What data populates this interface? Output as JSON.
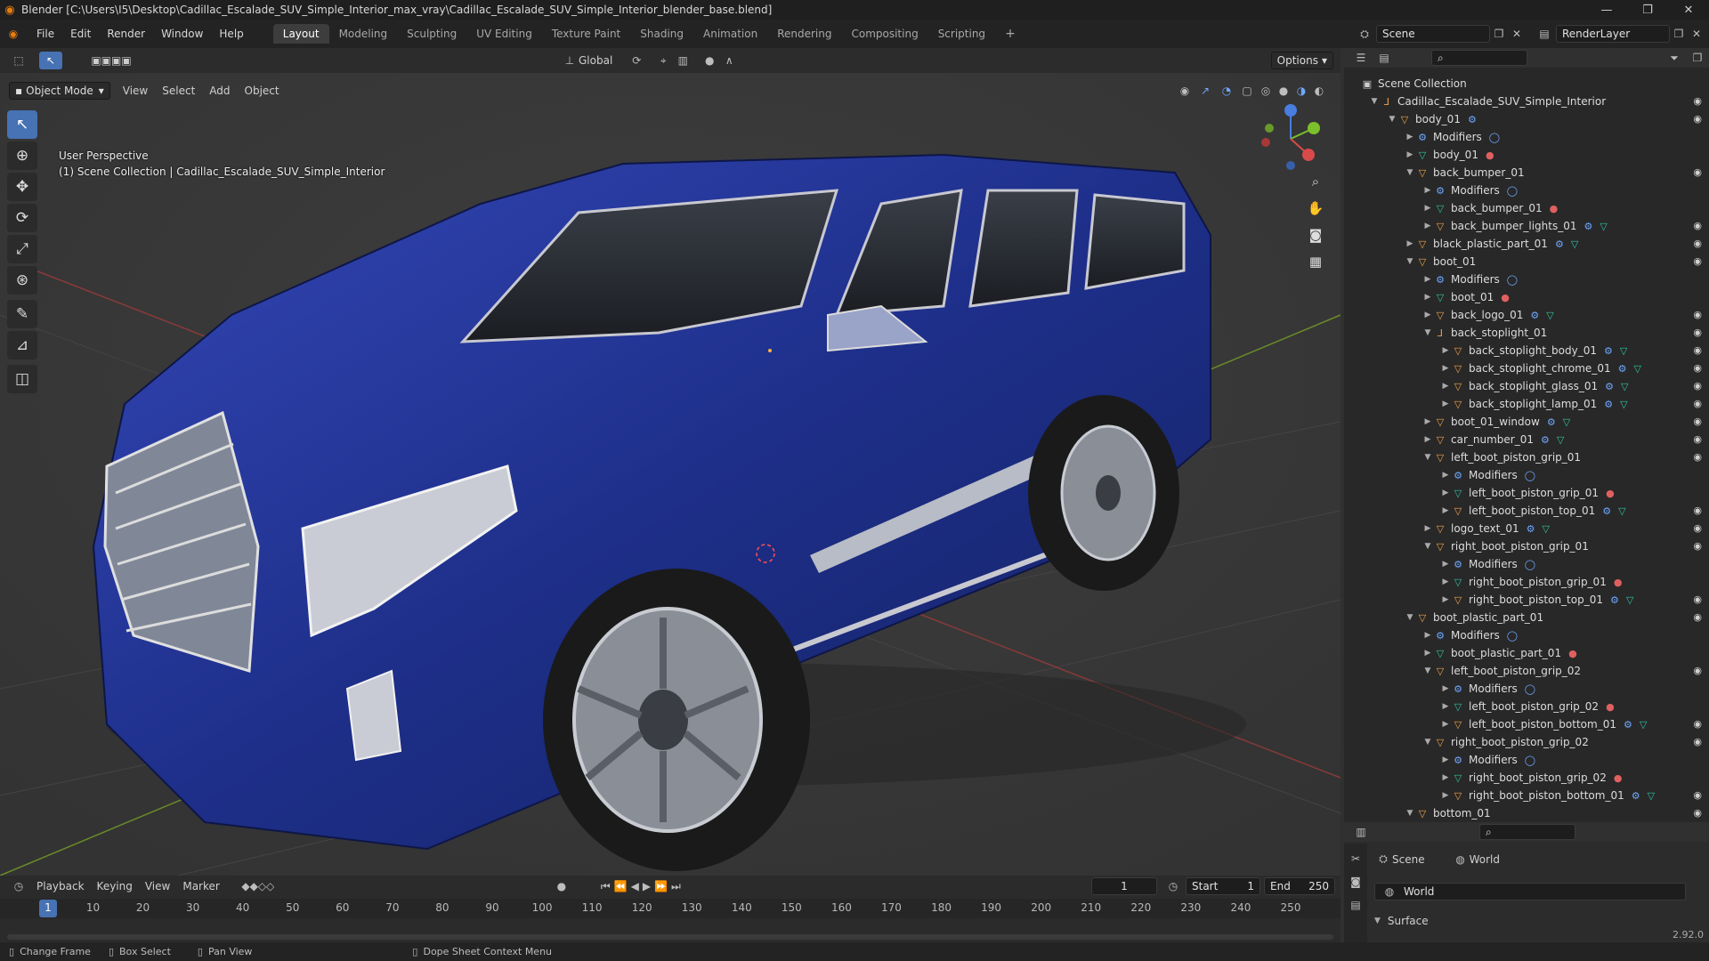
{
  "window": {
    "title": "Blender [C:\\Users\\I5\\Desktop\\Cadillac_Escalade_SUV_Simple_Interior_max_vray\\Cadillac_Escalade_SUV_Simple_Interior_blender_base.blend]"
  },
  "menu": [
    "File",
    "Edit",
    "Render",
    "Window",
    "Help"
  ],
  "workspaces": [
    {
      "label": "Layout",
      "active": true
    },
    {
      "label": "Modeling",
      "active": false
    },
    {
      "label": "Sculpting",
      "active": false
    },
    {
      "label": "UV Editing",
      "active": false
    },
    {
      "label": "Texture Paint",
      "active": false
    },
    {
      "label": "Shading",
      "active": false
    },
    {
      "label": "Animation",
      "active": false
    },
    {
      "label": "Rendering",
      "active": false
    },
    {
      "label": "Compositing",
      "active": false
    },
    {
      "label": "Scripting",
      "active": false
    }
  ],
  "scene": {
    "name": "Scene",
    "render_layer": "RenderLayer"
  },
  "viewport": {
    "mode": "Object Mode",
    "menus": [
      "View",
      "Select",
      "Add",
      "Object"
    ],
    "orientation": "Global",
    "options": "Options",
    "overlay_line1": "User Perspective",
    "overlay_line2": "(1) Scene Collection | Cadillac_Escalade_SUV_Simple_Interior"
  },
  "outliner": {
    "root": "Scene Collection",
    "rows": [
      {
        "label": "Cadillac_Escalade_SUV_Simple_Interior",
        "indent": 1,
        "type": "empty",
        "open": true,
        "eye": true
      },
      {
        "label": "body_01",
        "indent": 2,
        "type": "obj",
        "open": true,
        "eye": true,
        "extras": [
          "mod"
        ]
      },
      {
        "label": "Modifiers",
        "indent": 3,
        "type": "mod",
        "open": false,
        "eye": false,
        "extras": [
          "modset"
        ]
      },
      {
        "label": "body_01",
        "indent": 3,
        "type": "mesh",
        "open": false,
        "eye": false,
        "extras": [
          "mat"
        ]
      },
      {
        "label": "back_bumper_01",
        "indent": 3,
        "type": "obj",
        "open": true,
        "eye": true
      },
      {
        "label": "Modifiers",
        "indent": 4,
        "type": "mod",
        "open": false,
        "eye": false,
        "extras": [
          "modset"
        ]
      },
      {
        "label": "back_bumper_01",
        "indent": 4,
        "type": "mesh",
        "open": false,
        "eye": false,
        "extras": [
          "mat"
        ]
      },
      {
        "label": "back_bumper_lights_01",
        "indent": 4,
        "type": "obj",
        "open": false,
        "eye": true,
        "extras": [
          "mod",
          "mesh"
        ]
      },
      {
        "label": "black_plastic_part_01",
        "indent": 3,
        "type": "obj",
        "open": false,
        "eye": true,
        "extras": [
          "mod",
          "mesh"
        ]
      },
      {
        "label": "boot_01",
        "indent": 3,
        "type": "obj",
        "open": true,
        "eye": true
      },
      {
        "label": "Modifiers",
        "indent": 4,
        "type": "mod",
        "open": false,
        "eye": false,
        "extras": [
          "modset"
        ]
      },
      {
        "label": "boot_01",
        "indent": 4,
        "type": "mesh",
        "open": false,
        "eye": false,
        "extras": [
          "mat"
        ]
      },
      {
        "label": "back_logo_01",
        "indent": 4,
        "type": "obj",
        "open": false,
        "eye": true,
        "extras": [
          "mod",
          "mesh"
        ]
      },
      {
        "label": "back_stoplight_01",
        "indent": 4,
        "type": "empty",
        "open": true,
        "eye": true
      },
      {
        "label": "back_stoplight_body_01",
        "indent": 5,
        "type": "obj",
        "open": false,
        "eye": true,
        "extras": [
          "mod",
          "mesh"
        ]
      },
      {
        "label": "back_stoplight_chrome_01",
        "indent": 5,
        "type": "obj",
        "open": false,
        "eye": true,
        "extras": [
          "mod",
          "mesh"
        ]
      },
      {
        "label": "back_stoplight_glass_01",
        "indent": 5,
        "type": "obj",
        "open": false,
        "eye": true,
        "extras": [
          "mod",
          "mesh"
        ]
      },
      {
        "label": "back_stoplight_lamp_01",
        "indent": 5,
        "type": "obj",
        "open": false,
        "eye": true,
        "extras": [
          "mod",
          "mesh"
        ]
      },
      {
        "label": "boot_01_window",
        "indent": 4,
        "type": "obj",
        "open": false,
        "eye": true,
        "extras": [
          "mod",
          "mesh"
        ]
      },
      {
        "label": "car_number_01",
        "indent": 4,
        "type": "obj",
        "open": false,
        "eye": true,
        "extras": [
          "mod",
          "mesh"
        ]
      },
      {
        "label": "left_boot_piston_grip_01",
        "indent": 4,
        "type": "obj",
        "open": true,
        "eye": true
      },
      {
        "label": "Modifiers",
        "indent": 5,
        "type": "mod",
        "open": false,
        "eye": false,
        "extras": [
          "modset"
        ]
      },
      {
        "label": "left_boot_piston_grip_01",
        "indent": 5,
        "type": "mesh",
        "open": false,
        "eye": false,
        "extras": [
          "mat"
        ]
      },
      {
        "label": "left_boot_piston_top_01",
        "indent": 5,
        "type": "obj",
        "open": false,
        "eye": true,
        "extras": [
          "mod",
          "mesh"
        ]
      },
      {
        "label": "logo_text_01",
        "indent": 4,
        "type": "obj",
        "open": false,
        "eye": true,
        "extras": [
          "mod",
          "mesh"
        ]
      },
      {
        "label": "right_boot_piston_grip_01",
        "indent": 4,
        "type": "obj",
        "open": true,
        "eye": true
      },
      {
        "label": "Modifiers",
        "indent": 5,
        "type": "mod",
        "open": false,
        "eye": false,
        "extras": [
          "modset"
        ]
      },
      {
        "label": "right_boot_piston_grip_01",
        "indent": 5,
        "type": "mesh",
        "open": false,
        "eye": false,
        "extras": [
          "mat"
        ]
      },
      {
        "label": "right_boot_piston_top_01",
        "indent": 5,
        "type": "obj",
        "open": false,
        "eye": true,
        "extras": [
          "mod",
          "mesh"
        ]
      },
      {
        "label": "boot_plastic_part_01",
        "indent": 3,
        "type": "obj",
        "open": true,
        "eye": true
      },
      {
        "label": "Modifiers",
        "indent": 4,
        "type": "mod",
        "open": false,
        "eye": false,
        "extras": [
          "modset"
        ]
      },
      {
        "label": "boot_plastic_part_01",
        "indent": 4,
        "type": "mesh",
        "open": false,
        "eye": false,
        "extras": [
          "mat"
        ]
      },
      {
        "label": "left_boot_piston_grip_02",
        "indent": 4,
        "type": "obj",
        "open": true,
        "eye": true
      },
      {
        "label": "Modifiers",
        "indent": 5,
        "type": "mod",
        "open": false,
        "eye": false,
        "extras": [
          "modset"
        ]
      },
      {
        "label": "left_boot_piston_grip_02",
        "indent": 5,
        "type": "mesh",
        "open": false,
        "eye": false,
        "extras": [
          "mat"
        ]
      },
      {
        "label": "left_boot_piston_bottom_01",
        "indent": 5,
        "type": "obj",
        "open": false,
        "eye": true,
        "extras": [
          "mod",
          "mesh"
        ]
      },
      {
        "label": "right_boot_piston_grip_02",
        "indent": 4,
        "type": "obj",
        "open": true,
        "eye": true
      },
      {
        "label": "Modifiers",
        "indent": 5,
        "type": "mod",
        "open": false,
        "eye": false,
        "extras": [
          "modset"
        ]
      },
      {
        "label": "right_boot_piston_grip_02",
        "indent": 5,
        "type": "mesh",
        "open": false,
        "eye": false,
        "extras": [
          "mat"
        ]
      },
      {
        "label": "right_boot_piston_bottom_01",
        "indent": 5,
        "type": "obj",
        "open": false,
        "eye": true,
        "extras": [
          "mod",
          "mesh"
        ]
      },
      {
        "label": "bottom_01",
        "indent": 3,
        "type": "obj",
        "open": true,
        "eye": true
      }
    ]
  },
  "properties": {
    "scene_tab": "Scene",
    "world_tab": "World",
    "world_name": "World",
    "surface": "Surface"
  },
  "timeline": {
    "menus": [
      "Playback",
      "Keying",
      "View",
      "Marker"
    ],
    "current_frame": "1",
    "start_label": "Start",
    "start": "1",
    "end_label": "End",
    "end": "250",
    "ticks": [
      "1",
      "10",
      "20",
      "30",
      "40",
      "50",
      "60",
      "70",
      "80",
      "90",
      "100",
      "110",
      "120",
      "130",
      "140",
      "150",
      "160",
      "170",
      "180",
      "190",
      "200",
      "210",
      "220",
      "230",
      "240",
      "250"
    ]
  },
  "status": {
    "items": [
      "Change Frame",
      "Box Select",
      "Pan View",
      "Dope Sheet Context Menu"
    ],
    "version": "2.92.0"
  },
  "colors": {
    "accent": "#4772b3",
    "car": "#1e2f8a",
    "object": "#f0a34a",
    "modifier": "#6fa8ff",
    "mesh": "#2ec4a0",
    "material": "#e06060"
  }
}
